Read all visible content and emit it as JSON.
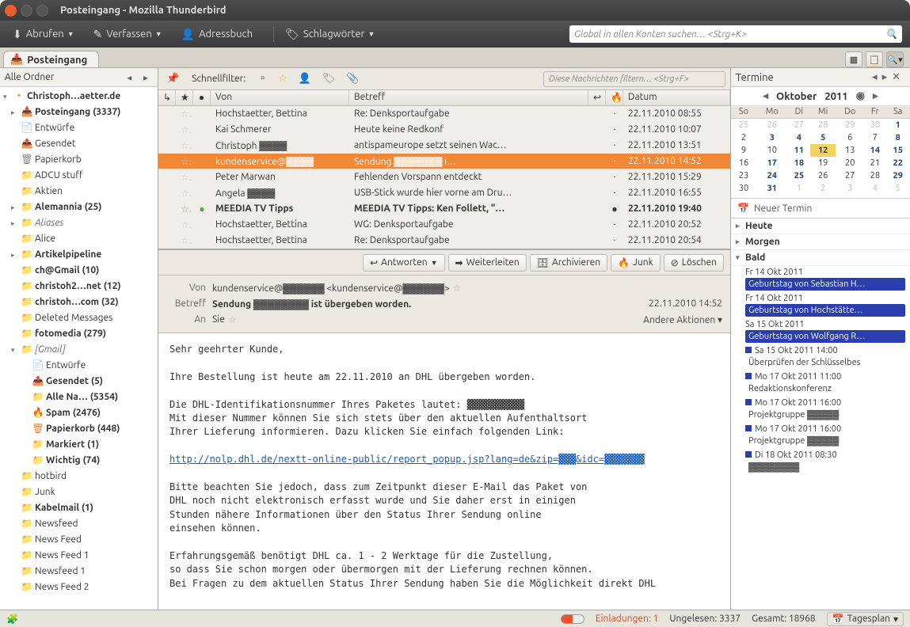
{
  "window": {
    "title": "Posteingang - Mozilla Thunderbird"
  },
  "toolbar": {
    "fetch": "Abrufen",
    "compose": "Verfassen",
    "addressbook": "Adressbuch",
    "tags": "Schlagwörter",
    "search_placeholder": "Global in allen Konten suchen… <Strg+K>"
  },
  "tab": {
    "label": "Posteingang"
  },
  "sidebar": {
    "header": "Alle Ordner",
    "folders": [
      {
        "label": "Christoph…aetter.de",
        "bold": true,
        "icon": "▾",
        "indent": 0
      },
      {
        "label": "Posteingang (3337)",
        "bold": true,
        "icon": "▸",
        "indent": 1,
        "fi": "📥"
      },
      {
        "label": "Entwürfe",
        "indent": 1,
        "fi": "📄",
        "gray": true
      },
      {
        "label": "Gesendet",
        "indent": 1,
        "fi": "📤",
        "gray": true
      },
      {
        "label": "Papierkorb",
        "indent": 1,
        "fi": "🗑",
        "gray": true
      },
      {
        "label": "ADCU stuff",
        "indent": 1,
        "fi": "📁"
      },
      {
        "label": "Aktien",
        "indent": 1,
        "fi": "📁"
      },
      {
        "label": "Alemannia (25)",
        "bold": true,
        "icon": "▸",
        "indent": 1,
        "fi": "📁"
      },
      {
        "label": "Aliases",
        "italic": true,
        "icon": "▸",
        "indent": 1,
        "fi": "📁"
      },
      {
        "label": "Alice",
        "indent": 1,
        "fi": "📁"
      },
      {
        "label": "Artikelpipeline",
        "bold": true,
        "icon": "▸",
        "indent": 1,
        "fi": "📁"
      },
      {
        "label": "ch@Gmail (10)",
        "bold": true,
        "indent": 1,
        "fi": "📁"
      },
      {
        "label": "christoh2…net (12)",
        "bold": true,
        "indent": 1,
        "fi": "📁"
      },
      {
        "label": "christoh…com (32)",
        "bold": true,
        "indent": 1,
        "fi": "📁"
      },
      {
        "label": "Deleted Messages",
        "indent": 1,
        "fi": "📁"
      },
      {
        "label": "fotomedia (279)",
        "bold": true,
        "indent": 1,
        "fi": "📁"
      },
      {
        "label": "[Gmail]",
        "italic": true,
        "icon": "▾",
        "indent": 1,
        "fi": "📁",
        "gray": true
      },
      {
        "label": "Entwürfe",
        "indent": 2,
        "fi": "📄",
        "gray": true
      },
      {
        "label": "Gesendet (5)",
        "bold": true,
        "indent": 2,
        "fi": "📤",
        "gray": true
      },
      {
        "label": "Alle Na… (5354)",
        "bold": true,
        "indent": 2,
        "fi": "📁"
      },
      {
        "label": "Spam (2476)",
        "bold": true,
        "indent": 2,
        "fi": "🔥"
      },
      {
        "label": "Papierkorb (448)",
        "bold": true,
        "indent": 2,
        "fi": "🗑"
      },
      {
        "label": "Markiert (1)",
        "bold": true,
        "indent": 2,
        "fi": "📁"
      },
      {
        "label": "Wichtig (74)",
        "bold": true,
        "indent": 2,
        "fi": "📁"
      },
      {
        "label": "hotbird",
        "indent": 1,
        "fi": "📁"
      },
      {
        "label": "Junk",
        "indent": 1,
        "fi": "📁"
      },
      {
        "label": "Kabelmail (1)",
        "bold": true,
        "indent": 1,
        "fi": "📁"
      },
      {
        "label": "Newsfeed",
        "indent": 1,
        "fi": "📁"
      },
      {
        "label": "News Feed",
        "indent": 1,
        "fi": "📁"
      },
      {
        "label": "News Feed 1",
        "indent": 1,
        "fi": "📁"
      },
      {
        "label": "Newsfeed 1",
        "indent": 1,
        "fi": "📁"
      },
      {
        "label": "News Feed 2",
        "indent": 1,
        "fi": "📁"
      }
    ]
  },
  "quickfilter": {
    "label": "Schnellfilter:",
    "placeholder": "Diese Nachrichten filtern… <Strg+F>"
  },
  "columns": {
    "from": "Von",
    "subject": "Betreff",
    "date": "Datum"
  },
  "messages": [
    {
      "from": "Hochstaetter, Bettina",
      "subject": "Re: Denksportaufgabe",
      "date": "22.11.2010 08:55"
    },
    {
      "from": "Kai Schmerer",
      "subject": "Heute keine Redkonf",
      "date": "22.11.2010 10:07"
    },
    {
      "from": "Christoph ▓▓▓▓",
      "subject": "antispameurope setzt seinen Wac…",
      "date": "22.11.2010 13:51"
    },
    {
      "from": "kundenservice@▓▓▓▓",
      "subject": "Sendung ▓▓▓▓▓▓▓ i…",
      "date": "22.11.2010 14:52",
      "selected": true
    },
    {
      "from": "Peter Marwan",
      "subject": "Fehlenden Vorspann entdeckt",
      "date": "22.11.2010 15:29"
    },
    {
      "from": "Angela ▓▓▓▓",
      "subject": "USB-Stick wurde hier vorne am Dru…",
      "date": "22.11.2010 16:55"
    },
    {
      "from": "MEEDIA TV Tipps",
      "subject": "MEEDIA TV Tipps: Ken Follett, \"…",
      "date": "22.11.2010 19:40",
      "bold": true,
      "dot": true
    },
    {
      "from": "Hochstaetter, Bettina",
      "subject": "WG: Denksportaufgabe",
      "date": "22.11.2010 20:52"
    },
    {
      "from": "Hochstaetter, Bettina",
      "subject": "Re: Denksportaufgabe",
      "date": "22.11.2010 20:54"
    }
  ],
  "actions": {
    "reply": "Antworten",
    "forward": "Weiterleiten",
    "archive": "Archivieren",
    "junk": "Junk",
    "delete": "Löschen"
  },
  "msg_header": {
    "from_label": "Von",
    "from_value": "kundenservice@▓▓▓▓▓▓ <kundenservice@▓▓▓▓▓▓>",
    "subject_label": "Betreff",
    "subject_value": "Sendung ▓▓▓▓▓▓▓▓ ist übergeben worden.",
    "to_label": "An",
    "to_value": "Sie",
    "date": "22.11.2010 14:52",
    "other_actions": "Andere Aktionen"
  },
  "msg_body": {
    "l1": "Sehr geehrter Kunde,",
    "l2": "Ihre Bestellung ist heute am 22.11.2010 an DHL übergeben worden.",
    "l3": "Die DHL-Identifikationsnummer Ihres Paketes lautet: ▓▓▓▓▓▓▓▓▓▓",
    "l4": "Mit dieser Nummer können Sie sich stets über den aktuellen Aufenthaltsort",
    "l5": "Ihrer Lieferung informieren. Dazu klicken Sie einfach folgenden Link:",
    "link": "http://nolp.dhl.de/nextt-online-public/report_popup.jsp?lang=de&zip=▓▓▓&idc=▓▓▓▓▓▓▓",
    "l6": "Bitte beachten Sie jedoch, dass zum Zeitpunkt dieser E-Mail das Paket von",
    "l7": "DHL noch nicht elektronisch erfasst wurde und Sie daher erst in einigen",
    "l8": "Stunden nähere Informationen über den Status Ihrer Sendung online",
    "l9": "einsehen können.",
    "l10": "Erfahrungsgemäß benötigt DHL ca. 1 - 2 Werktage für die Zustellung,",
    "l11": "so dass Sie schon morgen oder übermorgen mit der Lieferung rechnen können.",
    "l12": "Bei Fragen zu dem aktuellen Status Ihrer Sendung haben Sie die Möglichkeit direkt DHL"
  },
  "calendar": {
    "title": "Termine",
    "month": "Oktober",
    "year": "2011",
    "dow": [
      "So",
      "Mo",
      "Di",
      "Mi",
      "Do",
      "Fr",
      "Sa"
    ],
    "weeks": [
      [
        {
          "n": "25",
          "o": true
        },
        {
          "n": "26",
          "o": true
        },
        {
          "n": "27",
          "o": true
        },
        {
          "n": "28",
          "o": true
        },
        {
          "n": "29",
          "o": true
        },
        {
          "n": "30",
          "o": true
        },
        {
          "n": "1",
          "b": true
        }
      ],
      [
        {
          "n": "2"
        },
        {
          "n": "3",
          "b": true
        },
        {
          "n": "4",
          "b": true
        },
        {
          "n": "5",
          "b": true
        },
        {
          "n": "6"
        },
        {
          "n": "7"
        },
        {
          "n": "8",
          "b": true
        }
      ],
      [
        {
          "n": "9"
        },
        {
          "n": "10"
        },
        {
          "n": "11",
          "b": true
        },
        {
          "n": "12",
          "today": true
        },
        {
          "n": "13"
        },
        {
          "n": "14",
          "b": true
        },
        {
          "n": "15",
          "b": true
        }
      ],
      [
        {
          "n": "16"
        },
        {
          "n": "17",
          "b": true
        },
        {
          "n": "18",
          "b": true
        },
        {
          "n": "19"
        },
        {
          "n": "20"
        },
        {
          "n": "21"
        },
        {
          "n": "22",
          "b": true
        }
      ],
      [
        {
          "n": "23"
        },
        {
          "n": "24",
          "b": true
        },
        {
          "n": "25",
          "b": true
        },
        {
          "n": "26"
        },
        {
          "n": "27"
        },
        {
          "n": "28"
        },
        {
          "n": "29",
          "b": true
        }
      ],
      [
        {
          "n": "30"
        },
        {
          "n": "31",
          "b": true
        },
        {
          "n": "1",
          "o": true
        },
        {
          "n": "2",
          "o": true
        },
        {
          "n": "3",
          "o": true
        },
        {
          "n": "4",
          "o": true
        },
        {
          "n": "5",
          "o": true
        }
      ]
    ],
    "new_event": "Neuer Termin",
    "sections": {
      "today": "Heute",
      "tomorrow": "Morgen",
      "soon": "Bald"
    },
    "agenda": [
      {
        "date": "Fr 14 Okt 2011",
        "title": "Geburtstag von Sebastian H…",
        "hl": true
      },
      {
        "date": "Fr 14 Okt 2011",
        "title": "Geburtstag von Hochstätte…",
        "hl": true
      },
      {
        "date": "Sa 15 Okt 2011",
        "title": "Geburtstag von Wolfgang R…",
        "hl": true
      },
      {
        "date": "Sa 15 Okt 2011 14:00",
        "title": "Überprüfen der Schlüsselbes"
      },
      {
        "date": "Mo 17 Okt 2011 11:00",
        "title": "Redaktionskonferenz"
      },
      {
        "date": "Mo 17 Okt 2011 16:00",
        "title": "Projektgruppe ▓▓▓▓▓"
      },
      {
        "date": "Mo 17 Okt 2011 16:00",
        "title": "Projektgruppe ▓▓▓▓▓"
      },
      {
        "date": "Di 18 Okt 2011 08:30",
        "title": "▓▓▓▓▓▓▓▓"
      }
    ]
  },
  "statusbar": {
    "invitations": "Einladungen: 1",
    "unread": "Ungelesen: 3337",
    "total": "Gesamt: 18968",
    "dayplan": "Tagesplan"
  }
}
